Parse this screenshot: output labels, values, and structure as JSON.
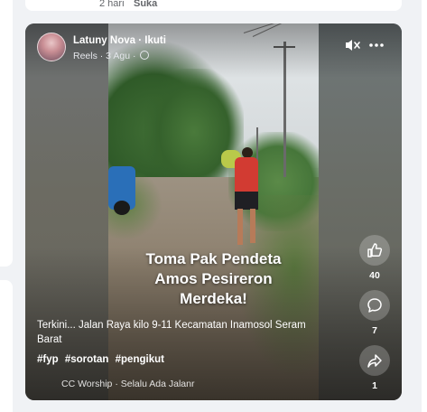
{
  "previous_post": {
    "time": "2 hari",
    "like": "Suka"
  },
  "reel": {
    "author": "Latuny Nova",
    "follow": "Ikuti",
    "meta": "Reels · 3 Agu ·",
    "overlay_lines": [
      "Toma Pak Pendeta",
      "Amos Pesireron",
      "Merdeka!"
    ],
    "caption": "Terkini... Jalan Raya kilo 9-11 Kecamatan Inamosol Seram Barat",
    "hashtags": [
      "#fyp",
      "#sorotan",
      "#pengikut"
    ],
    "music": "CC Worship · Selalu Ada Jalanr",
    "actions": [
      {
        "icon": "like-icon",
        "count": "40"
      },
      {
        "icon": "comment-icon",
        "count": "7"
      },
      {
        "icon": "share-icon",
        "count": "1"
      }
    ]
  }
}
